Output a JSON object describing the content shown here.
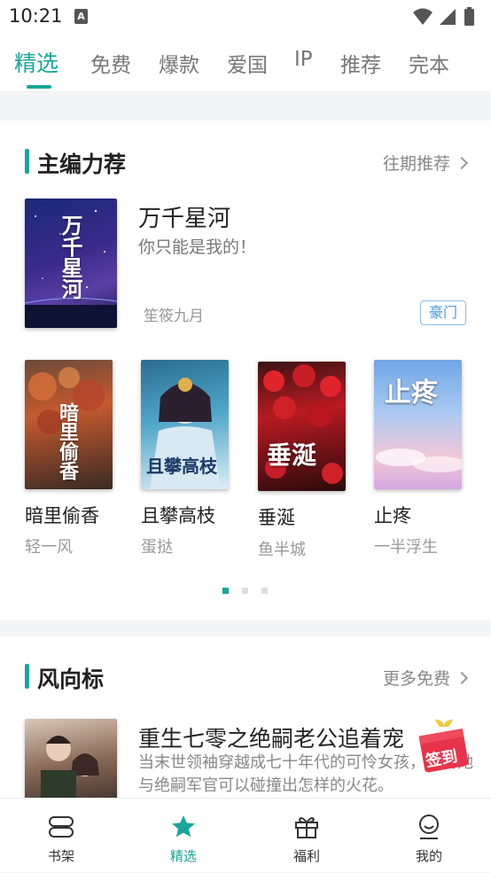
{
  "status": {
    "time": "10:21",
    "a_icon": "A"
  },
  "tabs": [
    {
      "label": "精选",
      "active": true
    },
    {
      "label": "免费"
    },
    {
      "label": "爆款"
    },
    {
      "label": "爱国"
    },
    {
      "label": "IP"
    },
    {
      "label": "推荐"
    },
    {
      "label": "完本"
    }
  ],
  "editor_section": {
    "title": "主编力荐",
    "more": "往期推荐",
    "featured": {
      "title": "万千星河",
      "description": "你只能是我的！",
      "author": "笙筱九月",
      "tag": "豪门",
      "cover_text": "万千星河"
    },
    "books": [
      {
        "title": "暗里偷香",
        "author": "轻一风",
        "cover_text": "暗里偷香"
      },
      {
        "title": "且攀高枝",
        "author": "蛋挞",
        "cover_text": "且攀高枝"
      },
      {
        "title": "垂涎",
        "author": "鱼半城",
        "cover_text": "垂涎"
      },
      {
        "title": "止疼",
        "author": "一半浮生",
        "cover_text": "止疼"
      }
    ],
    "pager": {
      "count": 3,
      "active": 0
    }
  },
  "trend_section": {
    "title": "风向标",
    "more": "更多免费",
    "book": {
      "title": "重生七零之绝嗣老公追着宠",
      "description": "当末世领袖穿越成七十年代的可怜女孩，且看她与绝嗣军官可以碰撞出怎样的火花。"
    }
  },
  "signin_badge": "签到",
  "bottom_nav": [
    {
      "label": "书架",
      "icon": "bookshelf-icon"
    },
    {
      "label": "精选",
      "icon": "star-icon",
      "active": true
    },
    {
      "label": "福利",
      "icon": "gift-icon"
    },
    {
      "label": "我的",
      "icon": "profile-icon"
    }
  ],
  "colors": {
    "accent": "#1aa59a",
    "tag_blue": "#4a9ad4",
    "signin_red": "#e8334a"
  }
}
